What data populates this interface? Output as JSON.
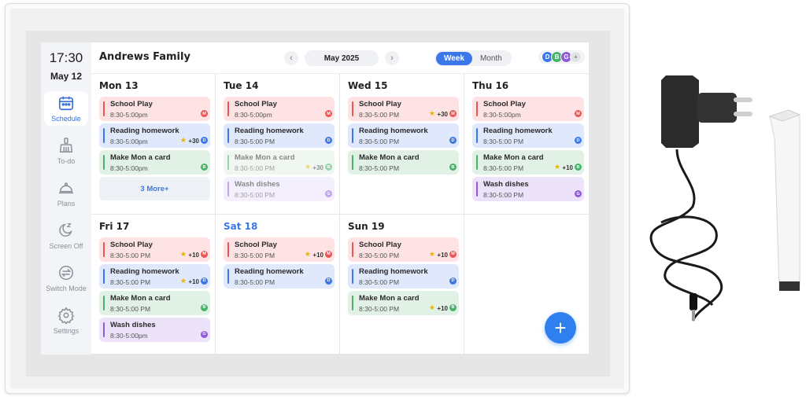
{
  "sidebar": {
    "time": "17:30",
    "date": "May 12",
    "items": [
      {
        "label": "Schedule",
        "icon": "calendar-icon",
        "active": true
      },
      {
        "label": "To-do",
        "icon": "broom-icon",
        "active": false
      },
      {
        "label": "Plans",
        "icon": "cloche-icon",
        "active": false
      },
      {
        "label": "Screen Off",
        "icon": "moon-sleep-icon",
        "active": false
      },
      {
        "label": "Switch Mode",
        "icon": "switch-arrows-icon",
        "active": false
      },
      {
        "label": "Settings",
        "icon": "gear-icon",
        "active": false
      }
    ]
  },
  "header": {
    "title": "Andrews Family",
    "month": "May 2025",
    "view_week": "Week",
    "view_month": "Month",
    "avatars": [
      {
        "initial": "D",
        "color": "#3b77e8"
      },
      {
        "initial": "B",
        "color": "#47b36a"
      },
      {
        "initial": "G",
        "color": "#8e5bd8"
      }
    ],
    "add_avatar": "+"
  },
  "colors": {
    "red_bg": "#fde3e3",
    "red_bar": "#e85656",
    "blue_bg": "#dfe9fb",
    "blue_bar": "#3b77e8",
    "green_bg": "#e2f1e5",
    "green_bar": "#47b36a",
    "purple_bg": "#ece3fa",
    "purple_bar": "#8e5bd8"
  },
  "days": [
    {
      "title": "Mon 13",
      "events": [
        {
          "title": "School Play",
          "time": "8:30-5:00pm",
          "color": "red",
          "initial": "M"
        },
        {
          "title": "Reading homework",
          "time": "8:30-5:00pm",
          "color": "blue",
          "initial": "D",
          "points": "+30"
        },
        {
          "title": "Make Mon a card",
          "time": "8:30-5:00pm",
          "color": "green",
          "initial": "B"
        }
      ],
      "more": "3 More+"
    },
    {
      "title": "Tue 14",
      "events": [
        {
          "title": "School Play",
          "time": "8:30-5:00pm",
          "color": "red",
          "initial": "M"
        },
        {
          "title": "Reading homework",
          "time": "8:30-5:00 PM",
          "color": "blue",
          "initial": "D"
        },
        {
          "title": "Make Mon a card",
          "time": "8:30-5:00 PM",
          "color": "green",
          "initial": "B",
          "points": "+30",
          "faded": true
        },
        {
          "title": "Wash dishes",
          "time": "8:30-5:00 PM",
          "color": "purple",
          "initial": "G",
          "faded": true
        }
      ]
    },
    {
      "title": "Wed 15",
      "events": [
        {
          "title": "School Play",
          "time": "8:30-5:00 PM",
          "color": "red",
          "initial": "M",
          "points": "+30"
        },
        {
          "title": "Reading homework",
          "time": "8:30-5:00 PM",
          "color": "blue",
          "initial": "D"
        },
        {
          "title": "Make Mon a card",
          "time": "8:30-5:00 PM",
          "color": "green",
          "initial": "B"
        }
      ]
    },
    {
      "title": "Thu 16",
      "events": [
        {
          "title": "School Play",
          "time": "8:30-5:00pm",
          "color": "red",
          "initial": "M"
        },
        {
          "title": "Reading homework",
          "time": "8:30-5:00 PM",
          "color": "blue",
          "initial": "D"
        },
        {
          "title": "Make Mon a card",
          "time": "8:30-5:00 PM",
          "color": "green",
          "initial": "B",
          "points": "+10"
        },
        {
          "title": "Wash dishes",
          "time": "8:30-5:00 PM",
          "color": "purple",
          "initial": "G"
        }
      ]
    },
    {
      "title": "Fri 17",
      "events": [
        {
          "title": "School Play",
          "time": "8:30-5:00 PM",
          "color": "red",
          "initial": "M",
          "points": "+10"
        },
        {
          "title": "Reading homework",
          "time": "8:30-5:00 PM",
          "color": "blue",
          "initial": "D",
          "points": "+10"
        },
        {
          "title": "Make Mon a card",
          "time": "8:30-5:00 PM",
          "color": "green",
          "initial": "B"
        },
        {
          "title": "Wash dishes",
          "time": "8:30-5:00pm",
          "color": "purple",
          "initial": "G"
        }
      ]
    },
    {
      "title": "Sat 18",
      "today": true,
      "events": [
        {
          "title": "School Play",
          "time": "8:30-5:00 PM",
          "color": "red",
          "initial": "M",
          "points": "+10"
        },
        {
          "title": "Reading homework",
          "time": "8:30-5:00 PM",
          "color": "blue",
          "initial": "D"
        }
      ]
    },
    {
      "title": "Sun 19",
      "events": [
        {
          "title": "School Play",
          "time": "8:30-5:00 PM",
          "color": "red",
          "initial": "M",
          "points": "+10"
        },
        {
          "title": "Reading homework",
          "time": "8:30-5:00 PM",
          "color": "blue",
          "initial": "D"
        },
        {
          "title": "Make Mon a card",
          "time": "8:30-5:00 PM",
          "color": "green",
          "initial": "B",
          "points": "+10"
        }
      ]
    },
    {
      "title": "",
      "events": []
    }
  ],
  "fab": "+"
}
